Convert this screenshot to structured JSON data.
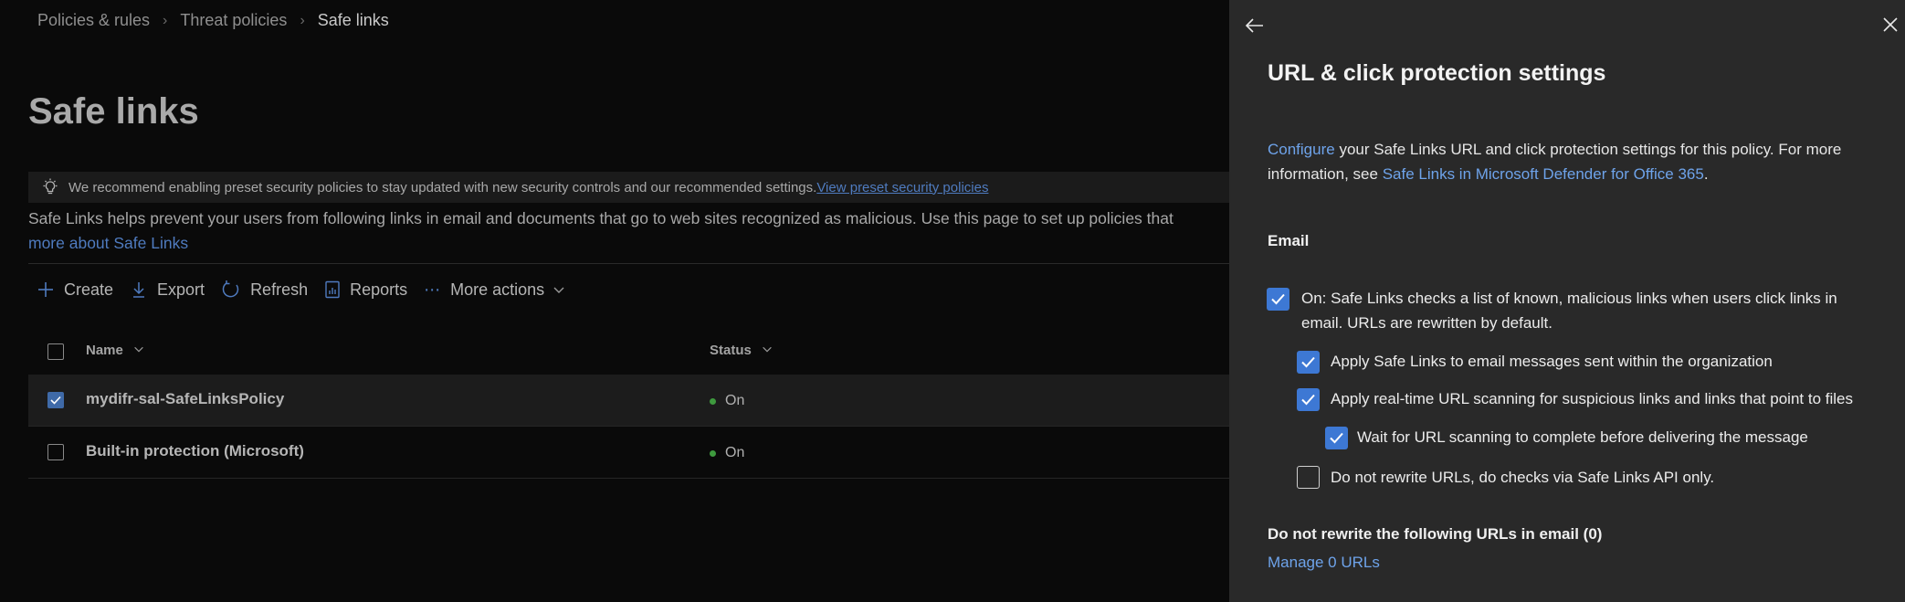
{
  "breadcrumb": [
    "Policies & rules",
    "Threat policies",
    "Safe links"
  ],
  "page": {
    "title": "Safe links",
    "banner_text": "We recommend enabling preset security policies to stay updated with new security controls and our recommended settings.",
    "banner_link": "View preset security policies",
    "description": "Safe Links helps prevent your users from following links in email and documents that go to web sites recognized as malicious. Use this page to set up policies that",
    "description_more": "more about Safe Links"
  },
  "toolbar": {
    "create": "Create",
    "export": "Export",
    "refresh": "Refresh",
    "reports": "Reports",
    "more_actions": "More actions"
  },
  "table": {
    "columns": {
      "name": "Name",
      "status": "Status"
    },
    "rows": [
      {
        "name": "mydifr-sal-SafeLinksPolicy",
        "status": "On",
        "selected": true
      },
      {
        "name": "Built-in protection (Microsoft)",
        "status": "On",
        "selected": false
      }
    ]
  },
  "panel": {
    "title": "URL & click protection settings",
    "intro_link1": "Configure",
    "intro_text1": " your Safe Links URL and click protection settings for this policy. For more information, see ",
    "intro_link2": "Safe Links in Microsoft Defender for Office 365",
    "intro_text2": ".",
    "section_email": "Email",
    "options": [
      {
        "label": "On: Safe Links checks a list of known, malicious links when users click links in email. URLs are rewritten by default.",
        "checked": true
      },
      {
        "label": "Apply Safe Links to email messages sent within the organization",
        "checked": true
      },
      {
        "label": "Apply real-time URL scanning for suspicious links and links that point to files",
        "checked": true
      },
      {
        "label": "Wait for URL scanning to complete before delivering the message",
        "checked": true
      },
      {
        "label": "Do not rewrite URLs, do checks via Safe Links API only.",
        "checked": false
      }
    ],
    "no_rewrite_heading": "Do not rewrite the following URLs in email (0)",
    "manage_link": "Manage 0 URLs"
  },
  "colors": {
    "accent": "#3d78d4",
    "link": "#6ea3ea",
    "status_on": "#3e9a3e",
    "panel_bg": "#292929"
  }
}
